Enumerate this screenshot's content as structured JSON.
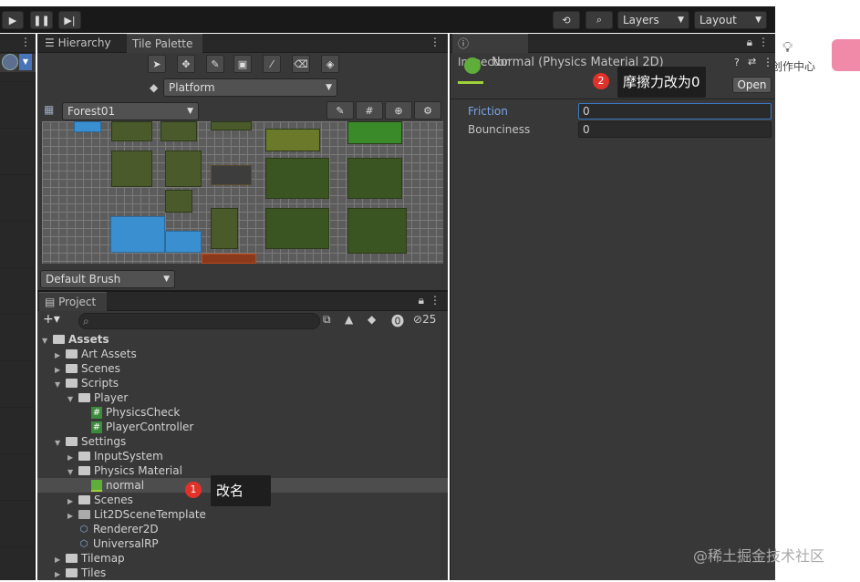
{
  "toolbar": {
    "layers": "Layers",
    "layout": "Layout"
  },
  "hierarchy_tab": "Hierarchy",
  "tile_palette_tab": "Tile Palette",
  "tile_palette": {
    "layer_dropdown": "Platform",
    "palette_dropdown": "Forest01",
    "brush_dropdown": "Default Brush"
  },
  "project": {
    "tab": "Project",
    "visible_count": "25",
    "tree": [
      {
        "label": "Assets",
        "depth": 0,
        "type": "folder",
        "expanded": true,
        "bold": true
      },
      {
        "label": "Art Assets",
        "depth": 1,
        "type": "folder",
        "expanded": false
      },
      {
        "label": "Scenes",
        "depth": 1,
        "type": "folder",
        "expanded": false
      },
      {
        "label": "Scripts",
        "depth": 1,
        "type": "folder",
        "expanded": true
      },
      {
        "label": "Player",
        "depth": 2,
        "type": "folder",
        "expanded": true
      },
      {
        "label": "PhysicsCheck",
        "depth": 3,
        "type": "script"
      },
      {
        "label": "PlayerController",
        "depth": 3,
        "type": "script"
      },
      {
        "label": "Settings",
        "depth": 1,
        "type": "folder",
        "expanded": true
      },
      {
        "label": "InputSystem",
        "depth": 2,
        "type": "folder",
        "expanded": false
      },
      {
        "label": "Physics Material",
        "depth": 2,
        "type": "folder",
        "expanded": true
      },
      {
        "label": "normal",
        "depth": 3,
        "type": "physics",
        "selected": true
      },
      {
        "label": "Scenes",
        "depth": 2,
        "type": "folder",
        "expanded": false
      },
      {
        "label": "Lit2DSceneTemplate",
        "depth": 2,
        "type": "template",
        "expanded": false
      },
      {
        "label": "Renderer2D",
        "depth": 2,
        "type": "asset"
      },
      {
        "label": "UniversalRP",
        "depth": 2,
        "type": "asset"
      },
      {
        "label": "Tilemap",
        "depth": 1,
        "type": "folder",
        "expanded": false
      },
      {
        "label": "Tiles",
        "depth": 1,
        "type": "folder",
        "expanded": false
      }
    ]
  },
  "inspector": {
    "tab": "Inspector",
    "title": "Normal (Physics Material 2D)",
    "open_button": "Open",
    "fields": [
      {
        "label": "Friction",
        "value": "0",
        "focused": true
      },
      {
        "label": "Bounciness",
        "value": "0",
        "focused": false
      }
    ]
  },
  "annotations": [
    {
      "num": "1",
      "text": "改名"
    },
    {
      "num": "2",
      "text": "摩擦力改为0"
    }
  ],
  "right_panel": {
    "text": "创作中心"
  },
  "watermark": "@稀土掘金技术社区",
  "colors": {
    "accent": "#7aa6ea",
    "selection": "#4d4d4d",
    "badge": "#e0322a",
    "pink": "#f08aa8"
  }
}
